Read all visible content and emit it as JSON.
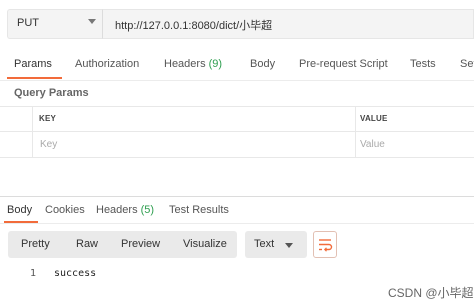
{
  "request": {
    "method": "PUT",
    "url": "http://127.0.0.1:8080/dict/小毕超"
  },
  "request_tabs": [
    {
      "label": "Params",
      "active": true
    },
    {
      "label": "Authorization"
    },
    {
      "label": "Headers",
      "count": "(9)"
    },
    {
      "label": "Body"
    },
    {
      "label": "Pre-request Script"
    },
    {
      "label": "Tests"
    },
    {
      "label": "Setti"
    }
  ],
  "query_params": {
    "title": "Query Params",
    "columns": [
      "KEY",
      "VALUE"
    ],
    "placeholders": {
      "key": "Key",
      "value": "Value"
    }
  },
  "response_tabs": [
    {
      "label": "Body",
      "active": true
    },
    {
      "label": "Cookies"
    },
    {
      "label": "Headers",
      "count": "(5)"
    },
    {
      "label": "Test Results"
    }
  ],
  "response_view": {
    "modes": [
      "Pretty",
      "Raw",
      "Preview",
      "Visualize"
    ],
    "format": "Text"
  },
  "response_body": {
    "lines": [
      {
        "num": "1",
        "text": "success"
      }
    ]
  },
  "watermark": "CSDN @小毕超",
  "colors": {
    "accent": "#f26b3a",
    "count_green": "#2e9e4f"
  }
}
